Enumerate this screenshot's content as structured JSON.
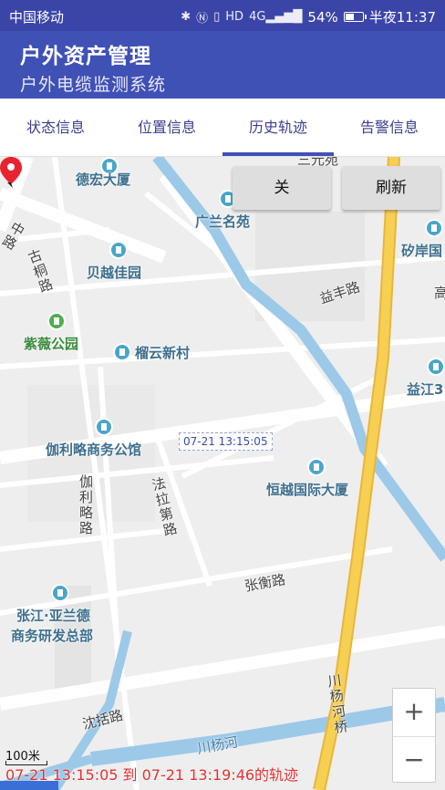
{
  "statusbar": {
    "carrier": "中国移动",
    "icons": [
      "bluetooth-icon",
      "nfc-icon",
      "vibrate-icon",
      "hd-icon",
      "4g-signal-icon",
      "battery-icon"
    ],
    "hd": "HD",
    "network": "4G",
    "battery_percent": "54%",
    "battery_level": 0.54,
    "time": "半夜11:37"
  },
  "appbar": {
    "title": "户外资产管理",
    "subtitle": "户外电缆监测系统",
    "color": "#3f51b5"
  },
  "tabs": [
    {
      "label": "状态信息",
      "active": false
    },
    {
      "label": "位置信息",
      "active": false
    },
    {
      "label": "历史轨迹",
      "active": true
    },
    {
      "label": "告警信息",
      "active": false
    }
  ],
  "map": {
    "buttons": {
      "close": "关",
      "refresh": "刷新"
    },
    "pois": {
      "dehong": "德宏大厦",
      "guanglan": "广兰名苑",
      "beiyue": "贝越佳园",
      "anzhe": "矽岸国",
      "ziwei": "紫薇公园",
      "liuyun": "榴云新村",
      "yijiang": "益江3",
      "jialilu": "伽利略商务公馆",
      "hengyue": "恒越国际大厦",
      "zhangjiang": "张江·亚兰德",
      "zhangjiang2": "商务研发总部"
    },
    "roads": {
      "yifeng": "益丰路",
      "gushiqiao": "古桐路",
      "zhonglu": "中路",
      "jialilu_road": "伽利略路",
      "falabi": "法拉第路",
      "zhangheng": "张衡路",
      "chuanyanghe_bridge": "川杨河桥",
      "shenkuo": "沈括路",
      "chuanyanghe": "川杨河",
      "top_partial": "三元苑",
      "right_partial": "高"
    },
    "trace_point_label": "07-21 13:15:05",
    "zoom_in": "+",
    "zoom_out": "−",
    "scale": "100米",
    "trace_summary": "07-21 13:15:05 到 07-21 13:19:46的轨迹"
  }
}
